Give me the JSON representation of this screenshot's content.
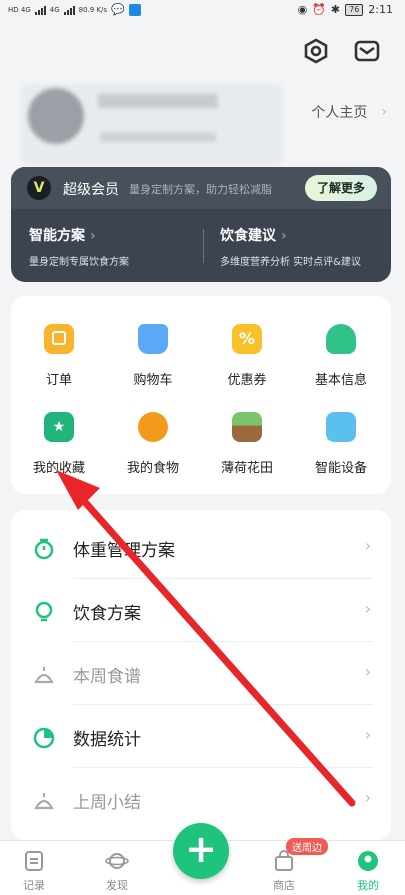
{
  "status_bar": {
    "signal1": "HD 4G",
    "signal2": "4G",
    "speed": "80.9 K/s",
    "battery": "76",
    "time": "2:11"
  },
  "profile": {
    "homepage_link": "个人主页"
  },
  "vip": {
    "title": "超级会员",
    "subtitle": "量身定制方案，助力轻松减脂",
    "button": "了解更多",
    "left": {
      "title": "智能方案",
      "desc": "量身定制专属饮食方案"
    },
    "right": {
      "title": "饮食建议",
      "desc": "多维度营养分析 实时点评&建议"
    }
  },
  "shortcuts": [
    {
      "label": "订单",
      "icon": "order-icon"
    },
    {
      "label": "购物车",
      "icon": "cart-icon"
    },
    {
      "label": "优惠券",
      "icon": "coupon-icon"
    },
    {
      "label": "基本信息",
      "icon": "user-info-icon"
    },
    {
      "label": "我的收藏",
      "icon": "favorites-icon"
    },
    {
      "label": "我的食物",
      "icon": "food-icon"
    },
    {
      "label": "薄荷花田",
      "icon": "field-icon"
    },
    {
      "label": "智能设备",
      "icon": "device-icon"
    }
  ],
  "menu": [
    {
      "label": "体重管理方案",
      "color": "#1fc47c"
    },
    {
      "label": "饮食方案",
      "color": "#1fc47c"
    },
    {
      "label": "本周食谱",
      "color": "#aaaaaa"
    },
    {
      "label": "数据统计",
      "color": "#1fc47c"
    },
    {
      "label": "上周小结",
      "color": "#aaaaaa"
    }
  ],
  "tabs": [
    {
      "label": "记录"
    },
    {
      "label": "发现"
    },
    {
      "label": "商店"
    },
    {
      "label": "我的"
    }
  ],
  "fab": "+",
  "shop_badge": "送周边",
  "colors": {
    "accent": "#1fc47c",
    "arrow": "#e8262a"
  }
}
